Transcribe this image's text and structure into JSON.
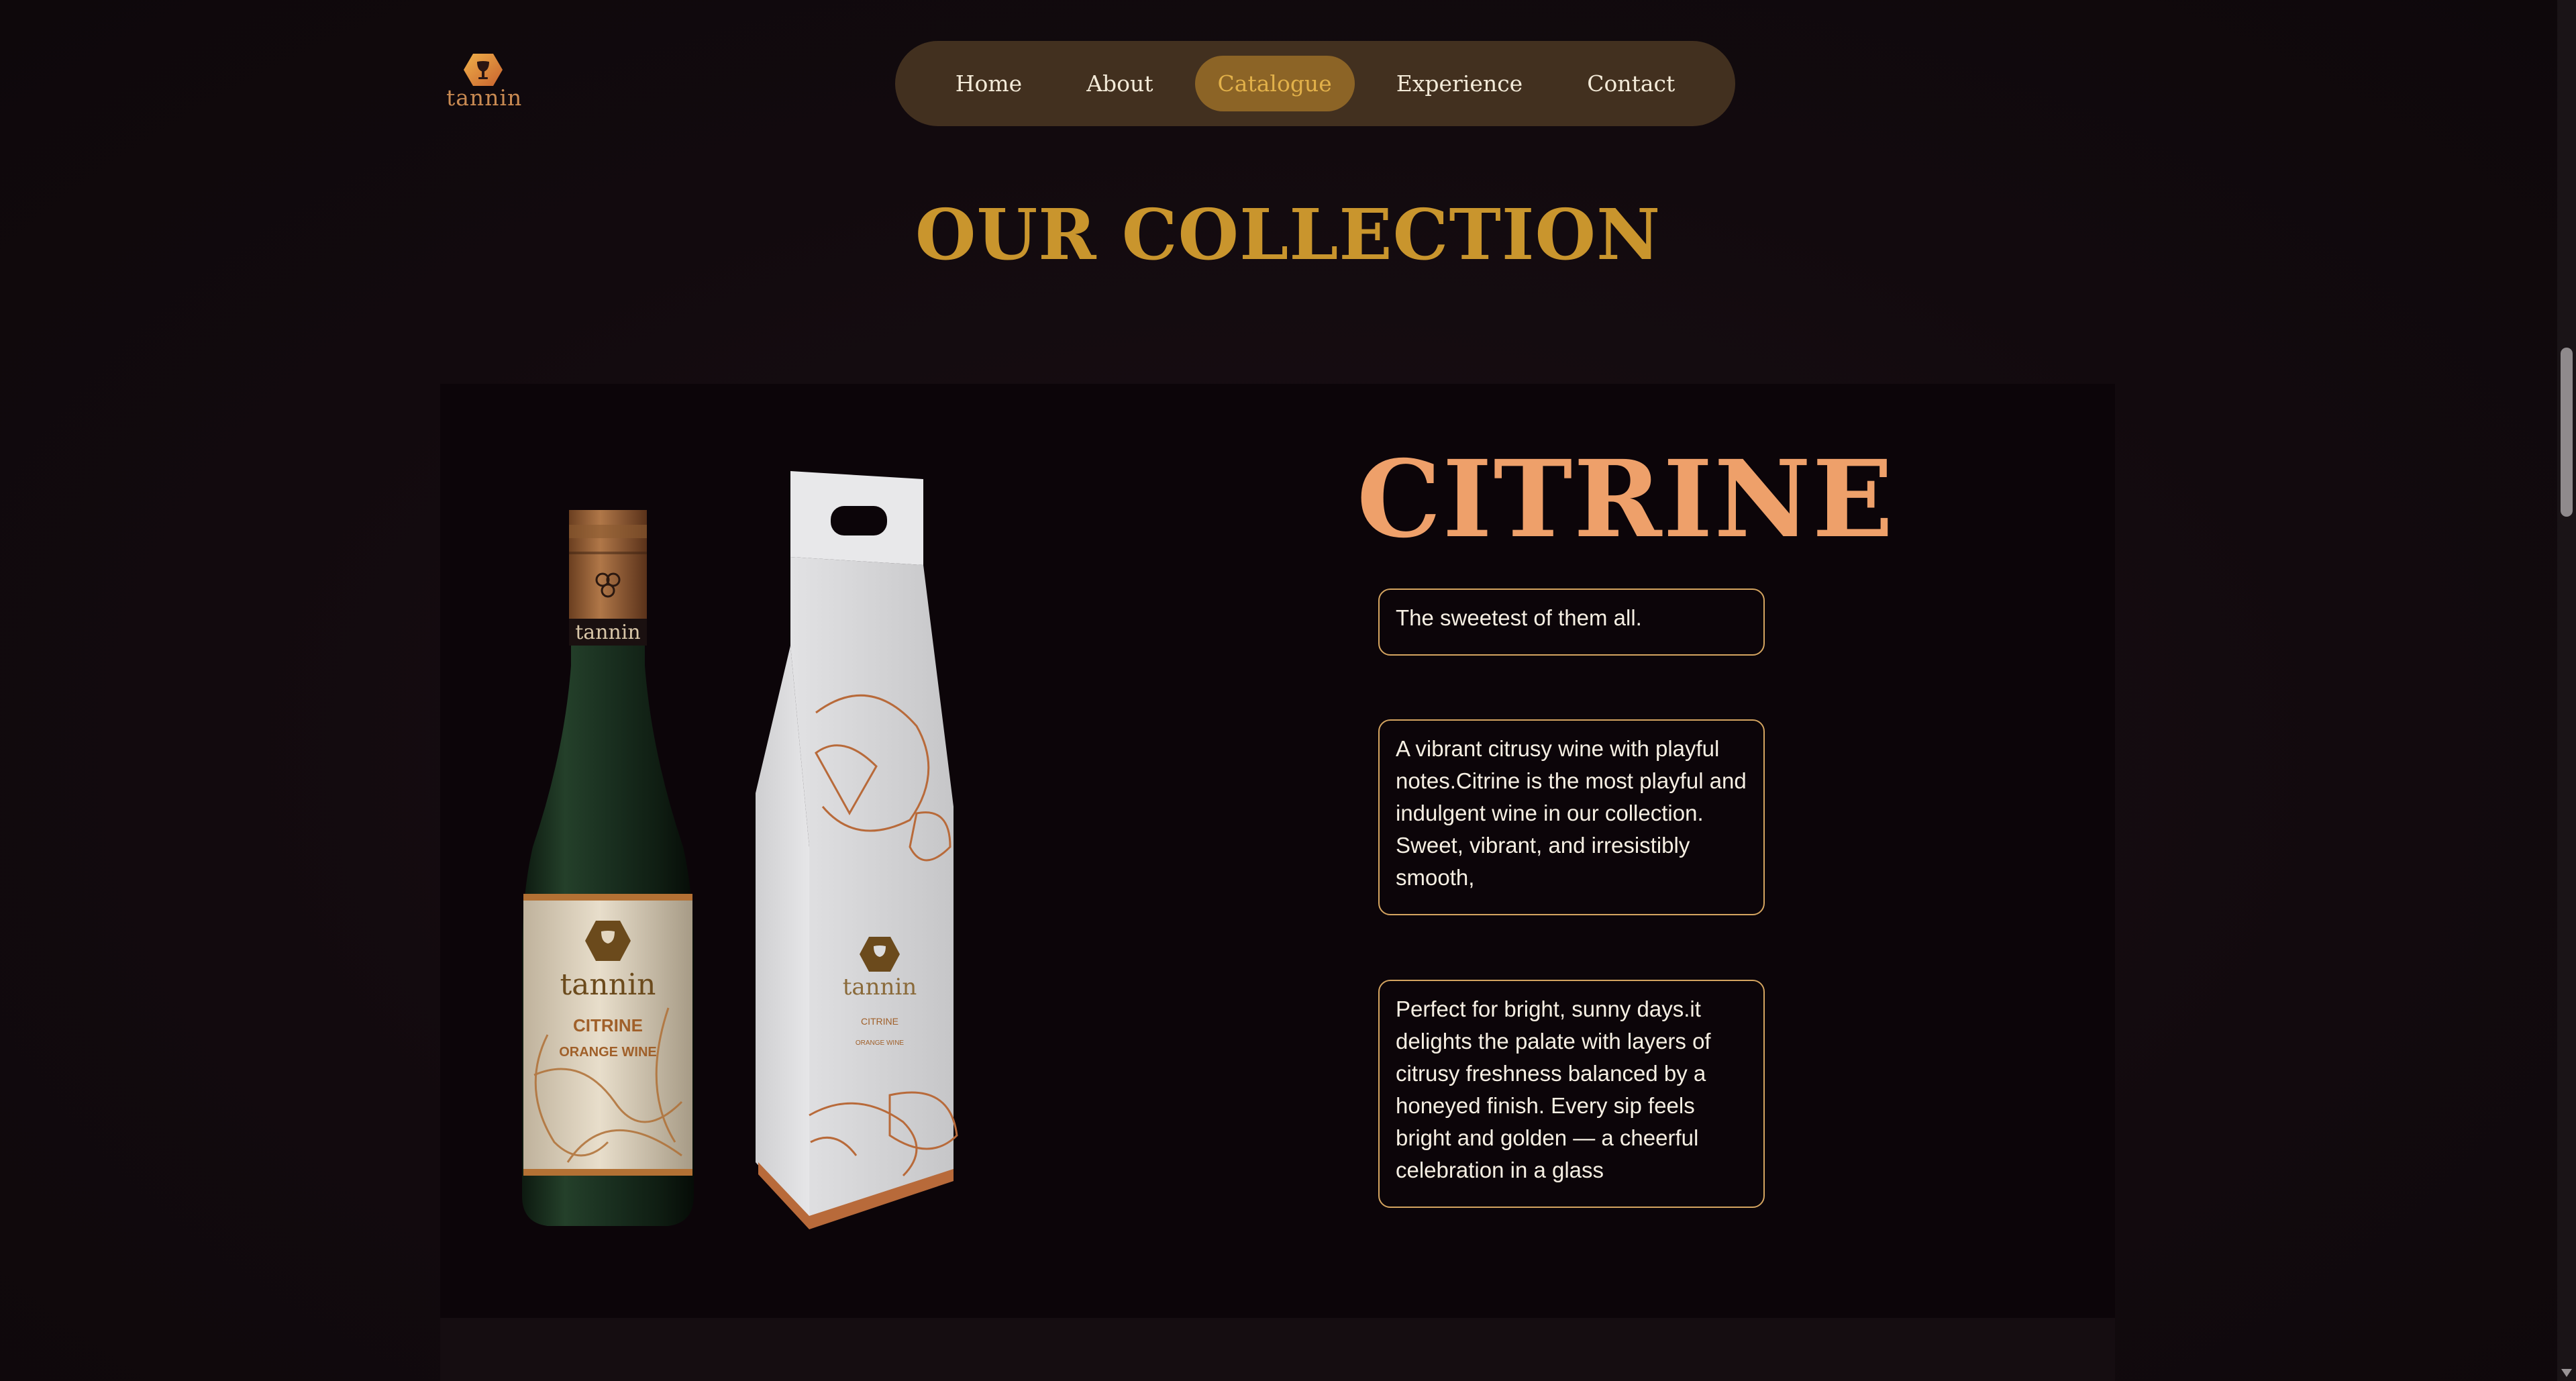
{
  "brand": {
    "name": "tannin",
    "logo_icon": "hexagon-wine-glass-icon",
    "accent_color": "#c9952d"
  },
  "nav": {
    "items": [
      {
        "label": "Home",
        "active": false
      },
      {
        "label": "About",
        "active": false
      },
      {
        "label": "Catalogue",
        "active": true
      },
      {
        "label": "Experience",
        "active": false
      },
      {
        "label": "Contact",
        "active": false
      }
    ]
  },
  "main": {
    "section_title": "OUR COLLECTION",
    "product": {
      "name": "CITRINE",
      "tagline": "The sweetest of them all.",
      "description": "A vibrant citrusy wine with playful notes.Citrine is the most playful and indulgent wine in our collection. Sweet, vibrant, and irresistibly smooth,",
      "pairing": "Perfect for bright, sunny days.it delights the palate with layers of citrusy freshness balanced by a honeyed finish. Every sip feels bright and golden — a cheerful celebration in a glass",
      "label": {
        "brand": "tannin",
        "wine_name": "CITRINE",
        "wine_type": "ORANGE WINE"
      },
      "packaging": {
        "brand": "tannin",
        "wine_name": "CITRINE",
        "wine_type": "ORANGE WINE"
      }
    }
  }
}
